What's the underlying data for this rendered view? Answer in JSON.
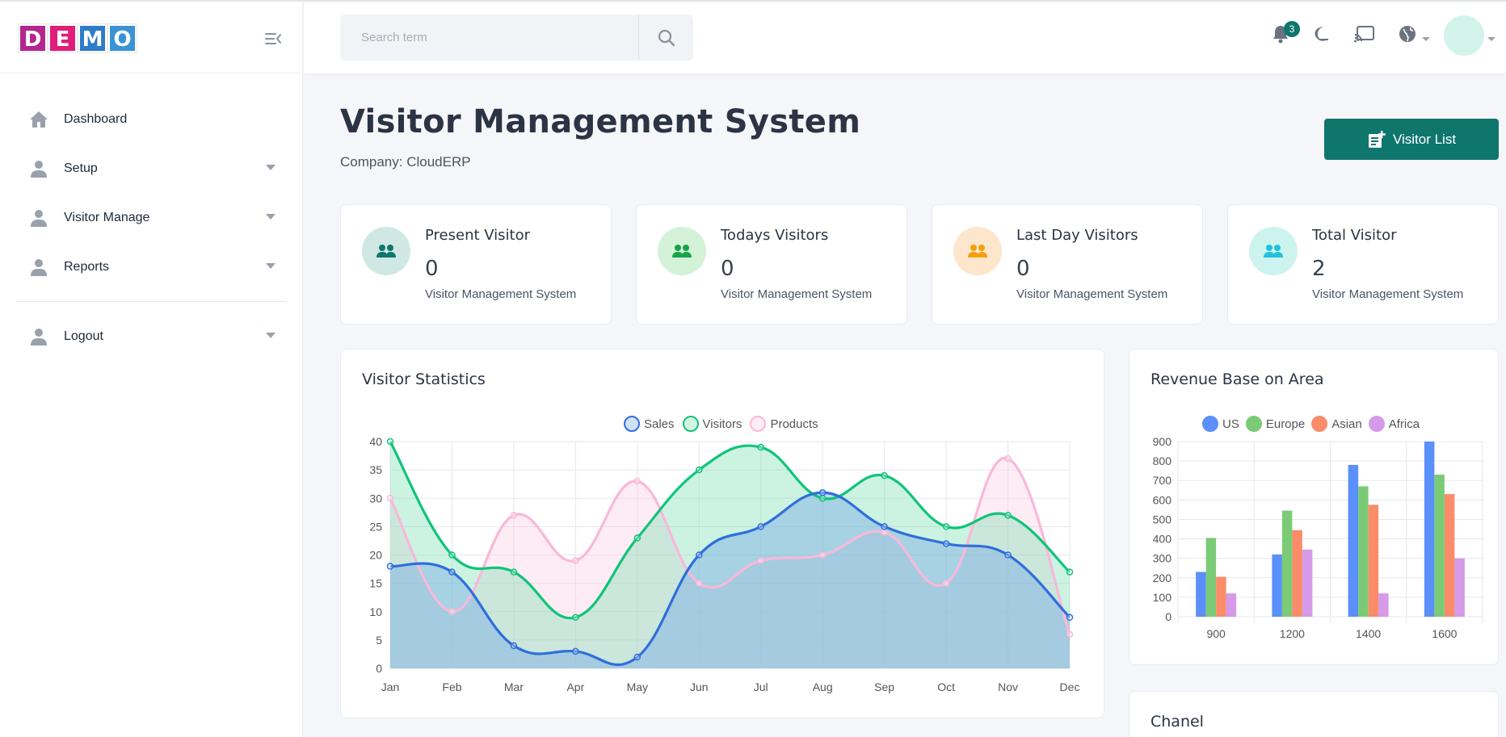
{
  "logo": {
    "letters": [
      "D",
      "E",
      "M",
      "O"
    ],
    "colors": [
      "#b4268f",
      "#e01e7a",
      "#2d7cc9",
      "#3a93d5"
    ]
  },
  "sidebar": {
    "items": [
      {
        "label": "Dashboard",
        "icon": "home-icon",
        "has_caret": false
      },
      {
        "label": "Setup",
        "icon": "user-icon",
        "has_caret": true
      },
      {
        "label": "Visitor Manage",
        "icon": "user-icon",
        "has_caret": true
      },
      {
        "label": "Reports",
        "icon": "user-icon",
        "has_caret": true
      },
      {
        "label": "Logout",
        "icon": "user-icon",
        "has_caret": true
      }
    ]
  },
  "header": {
    "search_placeholder": "Search term",
    "notification_count": "3",
    "icons": [
      "bell-icon",
      "moon-icon",
      "cast-icon",
      "globe-icon"
    ]
  },
  "main": {
    "title": "Visitor Management System",
    "company": "Company: CloudERP",
    "visitor_list_button": "Visitor List"
  },
  "stats": [
    {
      "title": "Present Visitor",
      "value": "0",
      "subtitle": "Visitor Management System",
      "bg": "#cfe8e4",
      "fg": "#0f766e"
    },
    {
      "title": "Todays Visitors",
      "value": "0",
      "subtitle": "Visitor Management System",
      "bg": "#d3f2d8",
      "fg": "#16a34a"
    },
    {
      "title": "Last Day Visitors",
      "value": "0",
      "subtitle": "Visitor Management System",
      "bg": "#fde6cc",
      "fg": "#f59e0b"
    },
    {
      "title": "Total Visitor",
      "value": "2",
      "subtitle": "Visitor Management System",
      "bg": "#cdf3ef",
      "fg": "#22c1dd"
    }
  ],
  "panels": {
    "visitor_statistics": "Visitor Statistics",
    "revenue": "Revenue Base on Area",
    "chanel": "Chanel"
  },
  "chart_data": [
    {
      "type": "area",
      "title": "Visitor Statistics",
      "categories": [
        "Jan",
        "Feb",
        "Mar",
        "Apr",
        "May",
        "Jun",
        "Jul",
        "Aug",
        "Sep",
        "Oct",
        "Nov",
        "Dec"
      ],
      "ylim": [
        0,
        40
      ],
      "yticks": [
        0,
        5,
        10,
        15,
        20,
        25,
        30,
        35,
        40
      ],
      "legend": "top-center",
      "grid": true,
      "series": [
        {
          "name": "Sales",
          "color": "#2f6fdb",
          "fill": "rgba(120,170,230,0.45)",
          "values": [
            18,
            17,
            4,
            3,
            2,
            20,
            25,
            31,
            25,
            22,
            20,
            9
          ]
        },
        {
          "name": "Visitors",
          "color": "#10c47a",
          "fill": "rgba(110,220,170,0.35)",
          "values": [
            40,
            20,
            17,
            9,
            23,
            35,
            39,
            30,
            34,
            25,
            27,
            17
          ]
        },
        {
          "name": "Products",
          "color": "#f9b8d9",
          "fill": "rgba(252,200,225,0.35)",
          "values": [
            30,
            10,
            27,
            19,
            33,
            15,
            19,
            20,
            24,
            15,
            37,
            6
          ]
        }
      ]
    },
    {
      "type": "bar",
      "title": "Revenue Base on Area",
      "categories": [
        "900",
        "1200",
        "1400",
        "1600"
      ],
      "ylim": [
        0,
        900
      ],
      "yticks": [
        0,
        100,
        200,
        300,
        400,
        500,
        600,
        700,
        800,
        900
      ],
      "legend": "top-center",
      "grid": true,
      "series": [
        {
          "name": "US",
          "color": "#5b8ff9",
          "values": [
            230,
            320,
            780,
            900
          ]
        },
        {
          "name": "Europe",
          "color": "#7bcb76",
          "values": [
            405,
            545,
            670,
            730
          ]
        },
        {
          "name": "Asian",
          "color": "#fb8c6a",
          "values": [
            205,
            445,
            575,
            630
          ]
        },
        {
          "name": "Africa",
          "color": "#d59ae8",
          "values": [
            120,
            345,
            120,
            300
          ]
        }
      ]
    }
  ]
}
